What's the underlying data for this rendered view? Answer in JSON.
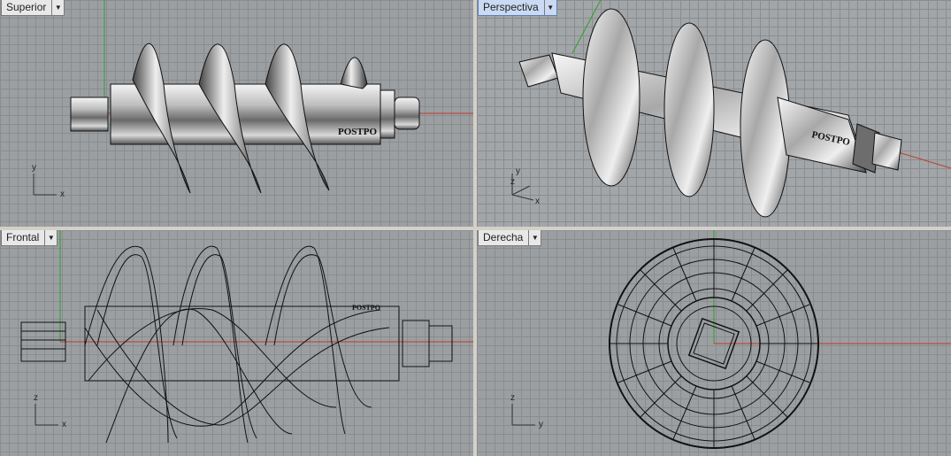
{
  "viewports": {
    "top": {
      "title": "Superior",
      "axis_h": "x",
      "axis_v": "y",
      "active": false
    },
    "perspective": {
      "title": "Perspectiva",
      "axis_h": "x",
      "axis_v": "y",
      "axis_d": "z",
      "active": true
    },
    "front": {
      "title": "Frontal",
      "axis_h": "x",
      "axis_v": "z",
      "active": false
    },
    "right": {
      "title": "Derecha",
      "axis_h": "y",
      "axis_v": "z",
      "active": false
    }
  },
  "model": {
    "logo_text": "POSTPO"
  },
  "colors": {
    "grid_bg": "#9c9fa2",
    "grid_line": "#8a8d90",
    "axis_x": "#c0392b",
    "axis_y": "#2ca02c",
    "active_tab": "#c9daf2"
  },
  "icons": {
    "viewport_menu": "dropdown-arrow-icon"
  }
}
